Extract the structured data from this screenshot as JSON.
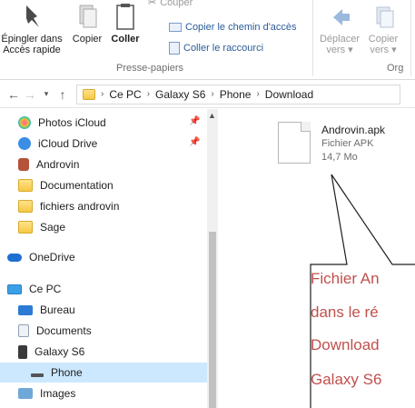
{
  "ribbon": {
    "pin_label_1": "Épingler dans",
    "pin_label_2": "Accès rapide",
    "copy_label": "Copier",
    "paste_label": "Coller",
    "cut_label": "Couper",
    "copy_path_label": "Copier le chemin d'accès",
    "paste_shortcut_label": "Coller le raccourci",
    "move_label_1": "Déplacer",
    "move_label_2": "vers",
    "copyto_label_1": "Copier",
    "copyto_label_2": "vers",
    "clipboard_group": "Presse-papiers",
    "organize_group": "Org"
  },
  "address": {
    "crumbs": [
      "Ce PC",
      "Galaxy S6",
      "Phone",
      "Download"
    ]
  },
  "nav": {
    "quick": [
      {
        "label": "Photos iCloud",
        "pinned": true
      },
      {
        "label": "iCloud Drive",
        "pinned": true
      },
      {
        "label": "Androvin",
        "pinned": false
      },
      {
        "label": "Documentation",
        "pinned": false
      },
      {
        "label": "fichiers androvin",
        "pinned": false
      },
      {
        "label": "Sage",
        "pinned": false
      }
    ],
    "onedrive": "OneDrive",
    "thispc": "Ce PC",
    "pc_items": [
      "Bureau",
      "Documents",
      "Galaxy S6",
      "Phone",
      "Images"
    ]
  },
  "file": {
    "name": "Androvin.apk",
    "type": "Fichier APK",
    "size": "14,7 Mo"
  },
  "callout": {
    "lines": [
      "Fichier An",
      "dans le ré",
      "Download",
      "Galaxy S6"
    ]
  },
  "colors": {
    "selection": "#cce8ff",
    "callout_text": "#c0504d",
    "folder": "#f6c844"
  }
}
